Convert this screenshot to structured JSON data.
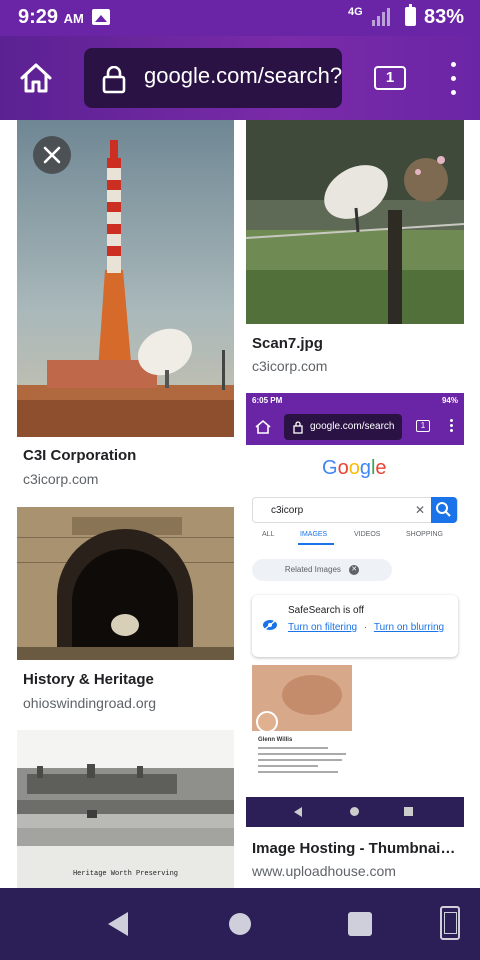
{
  "status_bar": {
    "time": "9:29",
    "ampm": "AM",
    "network": "4G",
    "battery": "83%"
  },
  "browser": {
    "url": "google.com/search?",
    "tab_count": "1"
  },
  "results": [
    {
      "title": "C3I Corporation",
      "source": "c3icorp.com"
    },
    {
      "title": "Scan7.jpg",
      "source": "c3icorp.com"
    },
    {
      "title": "History & Heritage",
      "source": "ohioswindingroad.org"
    },
    {
      "title": "Image Hosting - Thumbnail ...",
      "source": "www.uploadhouse.com"
    }
  ],
  "heritage_caption": "Heritage Worth Preserving",
  "inner_screenshot": {
    "time": "6:05 PM",
    "battery": "94%",
    "url": "google.com/search",
    "tab_count": "1",
    "logo": "Google",
    "query": "c3icorp",
    "tabs": [
      "ALL",
      "IMAGES",
      "VIDEOS",
      "SHOPPING"
    ],
    "related": "Related Images",
    "safesearch_title": "SafeSearch is off",
    "turn_on_filtering": "Turn on filtering",
    "separator": "·",
    "turn_on_blurring": "Turn on blurring",
    "post_author": "Glenn Willis"
  },
  "colors": {
    "purple": "#6a25a6",
    "nav": "#2c1f57",
    "link_blue": "#1a73e8"
  }
}
